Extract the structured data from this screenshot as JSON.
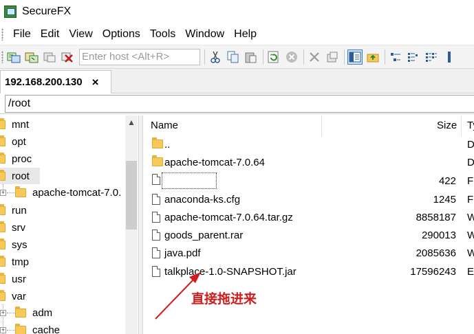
{
  "window": {
    "title": "SecureFX"
  },
  "menu": [
    "File",
    "Edit",
    "View",
    "Options",
    "Tools",
    "Window",
    "Help"
  ],
  "toolbar": {
    "host_placeholder": "Enter host <Alt+R>",
    "icons": [
      "connect-icon",
      "quick-connect-icon",
      "reconnect-icon",
      "disconnect-icon",
      "cut-icon",
      "copy-icon",
      "paste-icon",
      "refresh-icon",
      "stop-icon",
      "delete-icon",
      "properties-icon",
      "tree-view-icon",
      "up-folder-icon",
      "large-icons-icon",
      "small-icons-icon",
      "list-view-icon"
    ]
  },
  "tab": {
    "label": "192.168.200.130",
    "close": "×"
  },
  "path": "/root",
  "tree": [
    {
      "label": "mnt",
      "indent": 0
    },
    {
      "label": "opt",
      "indent": 0
    },
    {
      "label": "proc",
      "indent": 0
    },
    {
      "label": "root",
      "indent": 0,
      "selected": true
    },
    {
      "label": "apache-tomcat-7.0.",
      "indent": 1,
      "expandable": true
    },
    {
      "label": "run",
      "indent": 0
    },
    {
      "label": "srv",
      "indent": 0
    },
    {
      "label": "sys",
      "indent": 0
    },
    {
      "label": "tmp",
      "indent": 0
    },
    {
      "label": "usr",
      "indent": 0
    },
    {
      "label": "var",
      "indent": 0
    },
    {
      "label": "adm",
      "indent": 1,
      "expandable": true
    },
    {
      "label": "cache",
      "indent": 1,
      "expandable": true
    }
  ],
  "columns": {
    "name": "Name",
    "size": "Size",
    "type": "Ty"
  },
  "files": [
    {
      "name": "..",
      "size": "",
      "type": "D",
      "icon": "folder-icon"
    },
    {
      "name": "apache-tomcat-7.0.64",
      "size": "",
      "type": "D",
      "icon": "folder-icon"
    },
    {
      "name": "",
      "size": "422",
      "type": "Fi",
      "icon": "file-icon",
      "renaming": true
    },
    {
      "name": "anaconda-ks.cfg",
      "size": "1245",
      "type": "Fi",
      "icon": "file-icon"
    },
    {
      "name": "apache-tomcat-7.0.64.tar.gz",
      "size": "8858187",
      "type": "W",
      "icon": "file-icon"
    },
    {
      "name": "goods_parent.rar",
      "size": "290013",
      "type": "W",
      "icon": "file-icon"
    },
    {
      "name": "java.pdf",
      "size": "2085636",
      "type": "W",
      "icon": "file-icon"
    },
    {
      "name": "talkplace-1.0-SNAPSHOT.jar",
      "size": "17596243",
      "type": "Ex",
      "icon": "file-icon"
    }
  ],
  "annotation": {
    "text": "直接拖进来",
    "color": "#d01c1c"
  }
}
